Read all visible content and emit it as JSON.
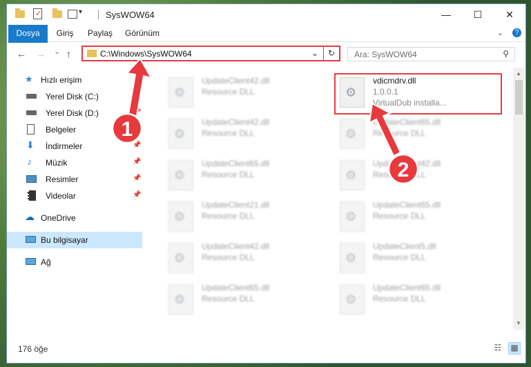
{
  "window": {
    "title": "SysWOW64",
    "minimize_glyph": "—",
    "maximize_glyph": "☐",
    "close_glyph": "✕"
  },
  "ribbon": {
    "tabs": [
      "Dosya",
      "Giriş",
      "Paylaş",
      "Görünüm"
    ],
    "expand_glyph": "⌄",
    "help_glyph": "?"
  },
  "nav": {
    "back_glyph": "←",
    "forward_glyph": "→",
    "recent_glyph": "⌄",
    "up_glyph": "↑",
    "address": "C:\\Windows\\SysWOW64",
    "dropdown_glyph": "⌄",
    "refresh_glyph": "↻",
    "search_placeholder": "Ara: SysWOW64",
    "search_glyph": "⚲"
  },
  "sidebar": {
    "items": [
      {
        "label": "Hızlı erişim",
        "icon": "star-icon",
        "pinned": false
      },
      {
        "label": "Yerel Disk (C:)",
        "icon": "drive-icon",
        "pinned": true
      },
      {
        "label": "Yerel Disk (D:)",
        "icon": "drive-icon",
        "pinned": true
      },
      {
        "label": "Belgeler",
        "icon": "documents-icon",
        "pinned": true
      },
      {
        "label": "İndirmeler",
        "icon": "download-icon",
        "pinned": true
      },
      {
        "label": "Müzik",
        "icon": "music-icon",
        "pinned": true
      },
      {
        "label": "Resimler",
        "icon": "pictures-icon",
        "pinned": true
      },
      {
        "label": "Videolar",
        "icon": "video-icon",
        "pinned": true
      },
      {
        "label": "OneDrive",
        "icon": "cloud-icon",
        "pinned": false
      },
      {
        "label": "Bu bilgisayar",
        "icon": "computer-icon",
        "pinned": false
      },
      {
        "label": "Ağ",
        "icon": "network-icon",
        "pinned": false
      }
    ],
    "pin_glyph": "📌"
  },
  "files": {
    "left": [
      {
        "name": "UpdateClient42.dll",
        "desc": "Resource DLL"
      },
      {
        "name": "UpdateClient42.dll",
        "desc": "Resource DLL"
      },
      {
        "name": "UpdateClient65.dll",
        "desc": "Resource DLL"
      },
      {
        "name": "UpdateClient21.dll",
        "desc": "Resource DLL"
      },
      {
        "name": "UpdateClient42.dll",
        "desc": "Resource DLL"
      },
      {
        "name": "UpdateClient65.dll",
        "desc": "Resource DLL"
      }
    ],
    "right": [
      {
        "name": "vdicmdrv.dll",
        "desc": "1.0.0.1",
        "desc2": "VirtualDub installa..."
      },
      {
        "name": "UpdateClient65.dll",
        "desc": "Resource DLL"
      },
      {
        "name": "UpdateClient42.dll",
        "desc": "Resource DLL"
      },
      {
        "name": "UpdateClient65.dll",
        "desc": "Resource DLL"
      },
      {
        "name": "UpdateClient5.dll",
        "desc": "Resource DLL"
      },
      {
        "name": "UpdateClient65.dll",
        "desc": "Resource DLL"
      }
    ]
  },
  "status": {
    "item_count": "176 öğe",
    "details_view_glyph": "☷",
    "tiles_view_glyph": "▦"
  },
  "annotations": {
    "step1": "1",
    "step2": "2",
    "accent": "#e8393d"
  },
  "colors": {
    "accent_blue": "#1979ca",
    "highlight_red": "#e8393d",
    "selection": "#cce8ff"
  }
}
